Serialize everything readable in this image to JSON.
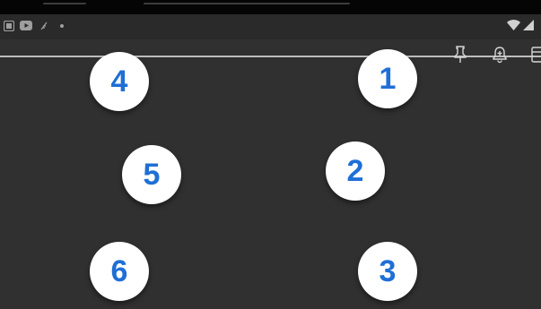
{
  "status_bar": {
    "left_icons": [
      "gallery-icon",
      "youtube-icon",
      "feather-icon",
      "dot-icon"
    ],
    "right_icons": [
      "wifi-icon",
      "signal-icon"
    ]
  },
  "toolbar": {
    "icons": [
      "pin-icon",
      "bell-icon",
      "archive-icon"
    ]
  },
  "numbers": {
    "n1": "1",
    "n2": "2",
    "n3": "3",
    "n4": "4",
    "n5": "5",
    "n6": "6"
  },
  "colors": {
    "background": "#303030",
    "number_text": "#1f6fd6",
    "circle_fill": "#ffffff",
    "divider": "#bdbdbd"
  }
}
